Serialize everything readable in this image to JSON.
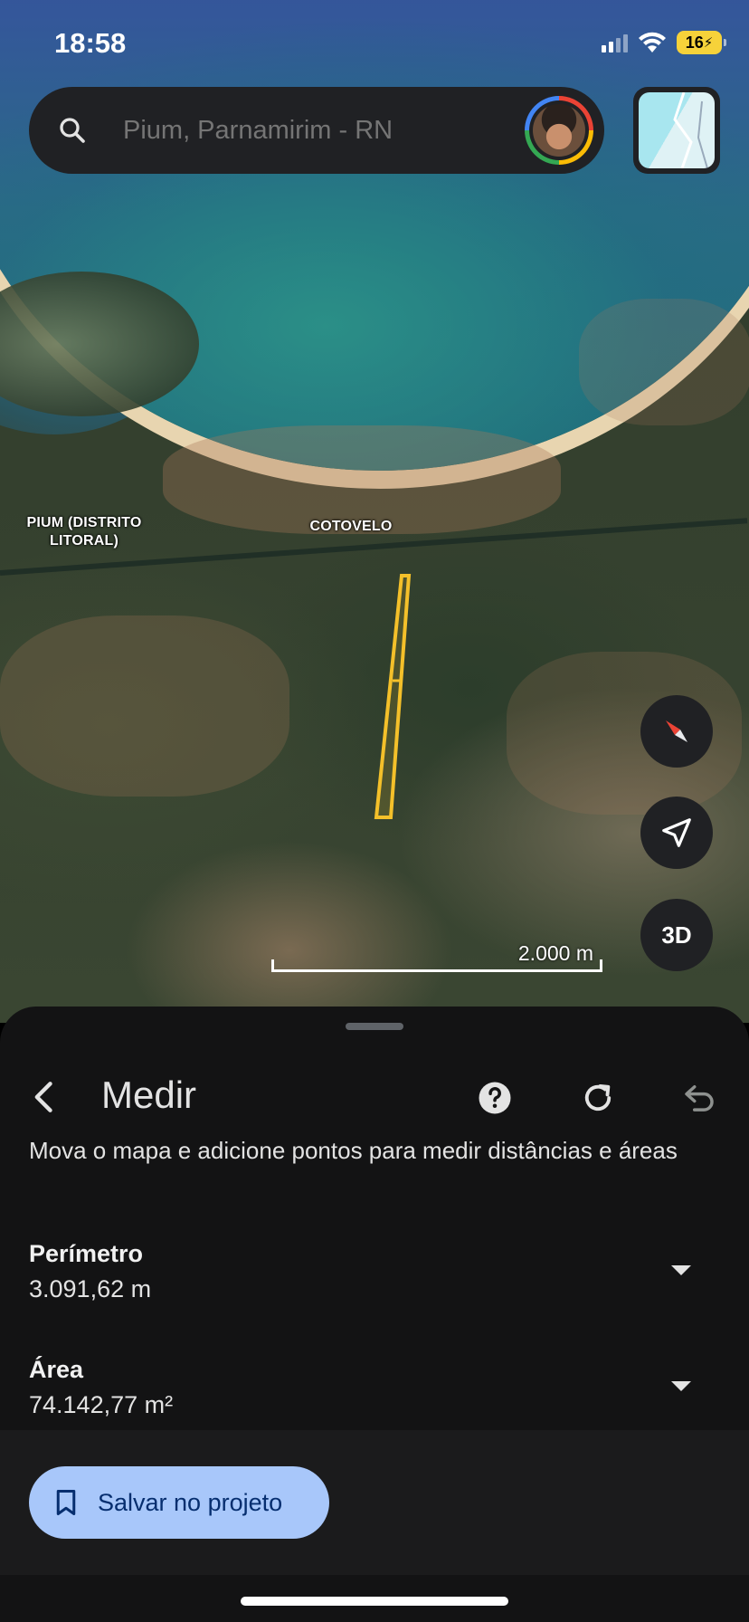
{
  "status_bar": {
    "time": "18:58",
    "battery": "16"
  },
  "search": {
    "placeholder": "Pium, Parnamirim - RN"
  },
  "map": {
    "labels": {
      "pium": "PIUM (DISTRITO\nLITORAL)",
      "cotovelo": "COTOVELO"
    },
    "scale_label": "2.000 m",
    "controls": {
      "three_d": "3D"
    },
    "polygon_color": "#f4c02a"
  },
  "sheet": {
    "title": "Medir",
    "description": "Mova o mapa e adicione pontos para medir distâncias e áreas",
    "perimeter": {
      "label": "Perímetro",
      "value": "3.091,62 m"
    },
    "area": {
      "label": "Área",
      "value": "74.142,77 m²"
    },
    "save_label": "Salvar no projeto"
  },
  "colors": {
    "accent_button": "#a8c7fa",
    "sheet_bg": "#131314"
  }
}
